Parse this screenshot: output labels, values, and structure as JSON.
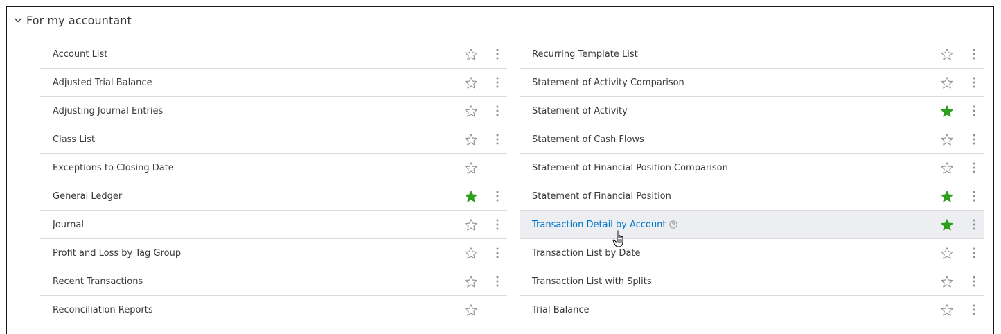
{
  "section": {
    "title": "For my accountant"
  },
  "left_reports": [
    {
      "label": "Account List",
      "favorite": false,
      "has_menu": true
    },
    {
      "label": "Adjusted Trial Balance",
      "favorite": false,
      "has_menu": true
    },
    {
      "label": "Adjusting Journal Entries",
      "favorite": false,
      "has_menu": true
    },
    {
      "label": "Class List",
      "favorite": false,
      "has_menu": true
    },
    {
      "label": "Exceptions to Closing Date",
      "favorite": false,
      "has_menu": false
    },
    {
      "label": "General Ledger",
      "favorite": true,
      "has_menu": true
    },
    {
      "label": "Journal",
      "favorite": false,
      "has_menu": true
    },
    {
      "label": "Profit and Loss by Tag Group",
      "favorite": false,
      "has_menu": true
    },
    {
      "label": "Recent Transactions",
      "favorite": false,
      "has_menu": true
    },
    {
      "label": "Reconciliation Reports",
      "favorite": false,
      "has_menu": false
    }
  ],
  "right_reports": [
    {
      "label": "Recurring Template List",
      "favorite": false,
      "has_menu": true
    },
    {
      "label": "Statement of Activity Comparison",
      "favorite": false,
      "has_menu": true
    },
    {
      "label": "Statement of Activity",
      "favorite": true,
      "has_menu": true
    },
    {
      "label": "Statement of Cash Flows",
      "favorite": false,
      "has_menu": true
    },
    {
      "label": "Statement of Financial Position Comparison",
      "favorite": false,
      "has_menu": true
    },
    {
      "label": "Statement of Financial Position",
      "favorite": true,
      "has_menu": true
    },
    {
      "label": "Transaction Detail by Account",
      "favorite": true,
      "has_menu": true,
      "hovered": true,
      "help_icon": "help-circle-icon"
    },
    {
      "label": "Transaction List by Date",
      "favorite": false,
      "has_menu": true
    },
    {
      "label": "Transaction List with Splits",
      "favorite": false,
      "has_menu": true
    },
    {
      "label": "Trial Balance",
      "favorite": false,
      "has_menu": true
    }
  ],
  "colors": {
    "favorite_star": "#2ca01c",
    "empty_star": "#8d9096",
    "link_hover": "#0077c5",
    "kebab": "#8d9096"
  }
}
